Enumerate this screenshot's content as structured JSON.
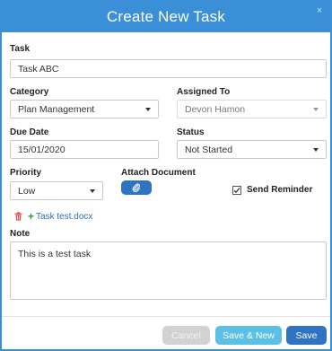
{
  "dialog": {
    "title": "Create New Task",
    "close_glyph": "×"
  },
  "form": {
    "task_label": "Task",
    "task_value": "Task ABC",
    "category_label": "Category",
    "category_value": "Plan Management",
    "assigned_label": "Assigned To",
    "assigned_value": "Devon Hamon",
    "due_label": "Due Date",
    "due_value": "15/01/2020",
    "status_label": "Status",
    "status_value": "Not Started",
    "priority_label": "Priority",
    "priority_value": "Low",
    "attach_label": "Attach Document",
    "reminder_label": "Send Reminder",
    "reminder_checked": true,
    "document_name": "Task test.docx",
    "note_label": "Note",
    "note_value": "This is a test task"
  },
  "footer": {
    "cancel_label": "Cancel",
    "save_new_label": "Save & New",
    "save_label": "Save"
  },
  "icons": {
    "attach": "paperclip-icon",
    "delete": "trash-icon",
    "add": "plus-icon",
    "close": "close-icon"
  },
  "colors": {
    "accent": "#3a8fd6",
    "primary_button": "#2f74c0",
    "secondary_button": "#5bbfe6",
    "disabled_button": "#d2d2d2",
    "delete_icon": "#d9534f",
    "add_icon": "#2e9a3e"
  }
}
